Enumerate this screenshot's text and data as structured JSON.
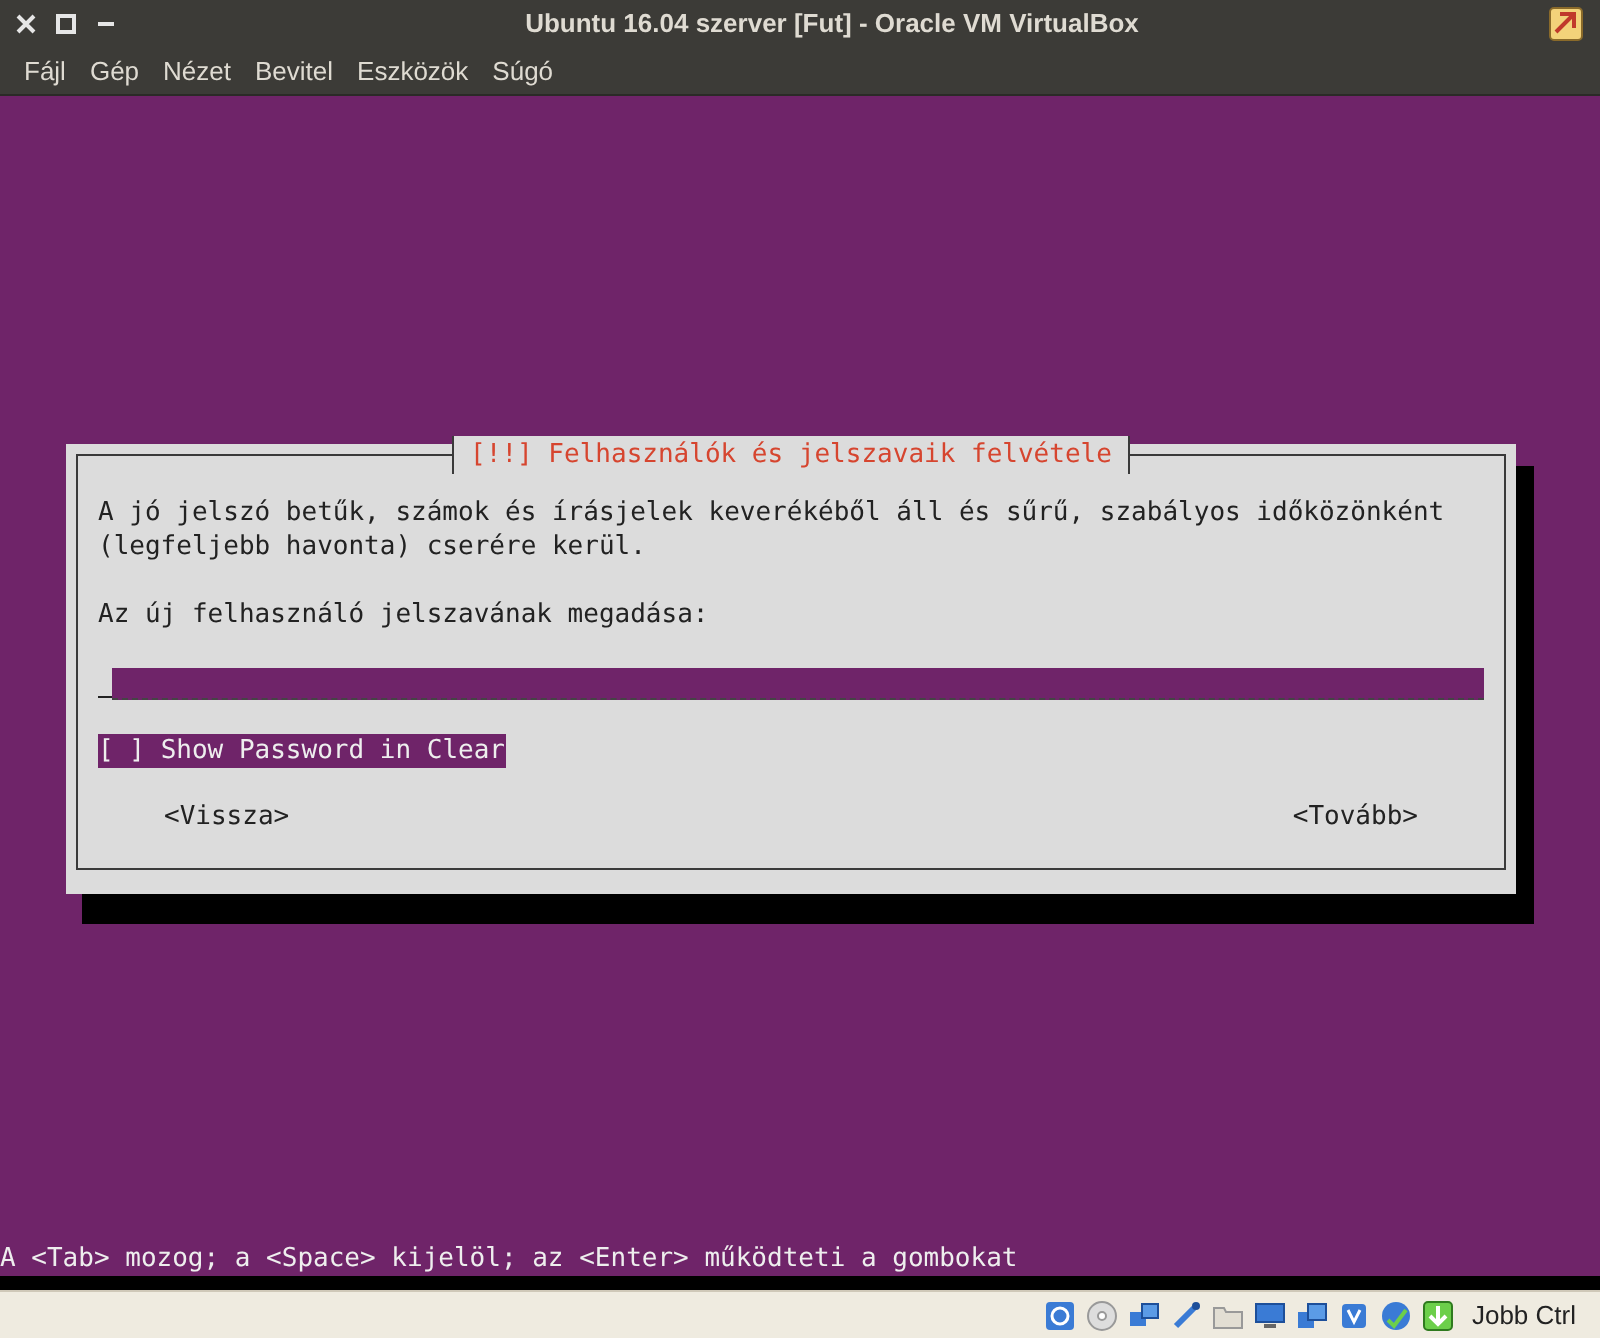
{
  "window": {
    "title": "Ubuntu 16.04 szerver [Fut] - Oracle VM VirtualBox"
  },
  "menu": [
    "Fájl",
    "Gép",
    "Nézet",
    "Bevitel",
    "Eszközök",
    "Súgó"
  ],
  "dialog": {
    "title": "[!!] Felhasználók és jelszavaik felvétele",
    "message": "A jó jelszó betűk, számok és írásjelek keverékéből áll és sűrű, szabályos időközönként (legfeljebb havonta) cserére kerül.",
    "prompt": "Az új felhasználó jelszavának megadása:",
    "password_field": {
      "focused": true
    },
    "checkbox": {
      "box": "[ ]",
      "label": "Show Password in Clear",
      "checked": false,
      "focused": true
    },
    "buttons": [
      {
        "label": "<Vissza>"
      },
      {
        "label": "<Tovább>"
      }
    ]
  },
  "hint": "A <Tab> mozog; a <Space> kijelöl; az <Enter> működteti a gombokat",
  "status_bar": {
    "host_key": "Jobb Ctrl"
  }
}
